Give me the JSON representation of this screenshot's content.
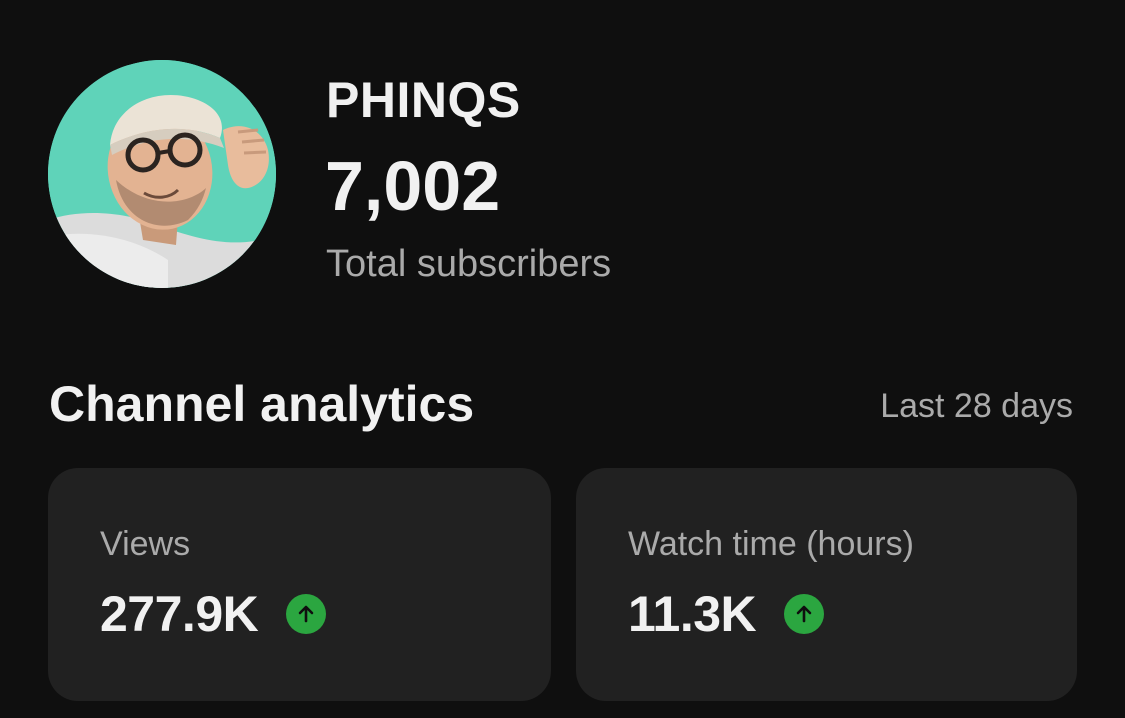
{
  "channel": {
    "name": "PHINQS",
    "subscriber_count": "7,002",
    "subscriber_label": "Total subscribers",
    "avatar_icon": "profile-photo"
  },
  "analytics": {
    "title": "Channel analytics",
    "period": "Last 28 days",
    "cards": [
      {
        "label": "Views",
        "value": "277.9K",
        "trend": "up",
        "trend_icon": "arrow-up-icon"
      },
      {
        "label": "Watch time (hours)",
        "value": "11.3K",
        "trend": "up",
        "trend_icon": "arrow-up-icon"
      }
    ]
  },
  "colors": {
    "background": "#0f0f0f",
    "card": "#212121",
    "trend_up": "#2ba640",
    "avatar_bg": "#5fd3b9",
    "secondary_text": "#aaaaaa"
  }
}
